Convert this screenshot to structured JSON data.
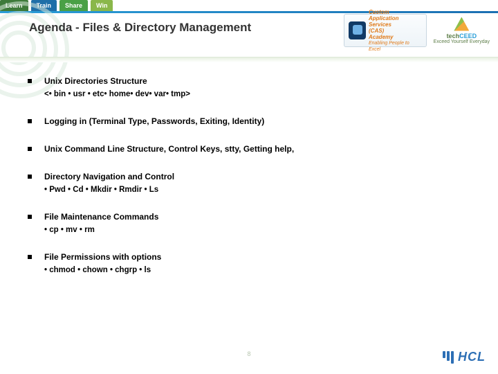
{
  "header": {
    "tabs": [
      "Learn",
      "Train",
      "Share",
      "Win"
    ],
    "title": "Agenda - Files & Directory Management",
    "cas_logo": {
      "line1": "Custom",
      "line2": "Application Services",
      "line3": "(CAS)",
      "line4": "Academy",
      "tagline": "Enabling People to Excel"
    },
    "techceed": {
      "name_prefix": "tech",
      "name_suffix": "CEED",
      "tagline": "Exceed Yourself Everyday"
    }
  },
  "agenda": [
    {
      "title": "Unix Directories Structure",
      "sub": "<• bin • usr • etc• home• dev• var• tmp>"
    },
    {
      "title": "Logging in (Terminal Type, Passwords, Exiting, Identity)",
      "sub": ""
    },
    {
      "title": "Unix Command Line Structure, Control Keys, stty, Getting help,",
      "sub": ""
    },
    {
      "title": "Directory Navigation and Control",
      "sub": "• Pwd • Cd • Mkdir • Rmdir • Ls"
    },
    {
      "title": "File Maintenance Commands",
      "sub": "• cp • mv • rm"
    },
    {
      "title": "File Permissions with options",
      "sub": "• chmod • chown • chgrp • ls"
    }
  ],
  "footer": {
    "page_number": "8",
    "brand": "HCL"
  }
}
